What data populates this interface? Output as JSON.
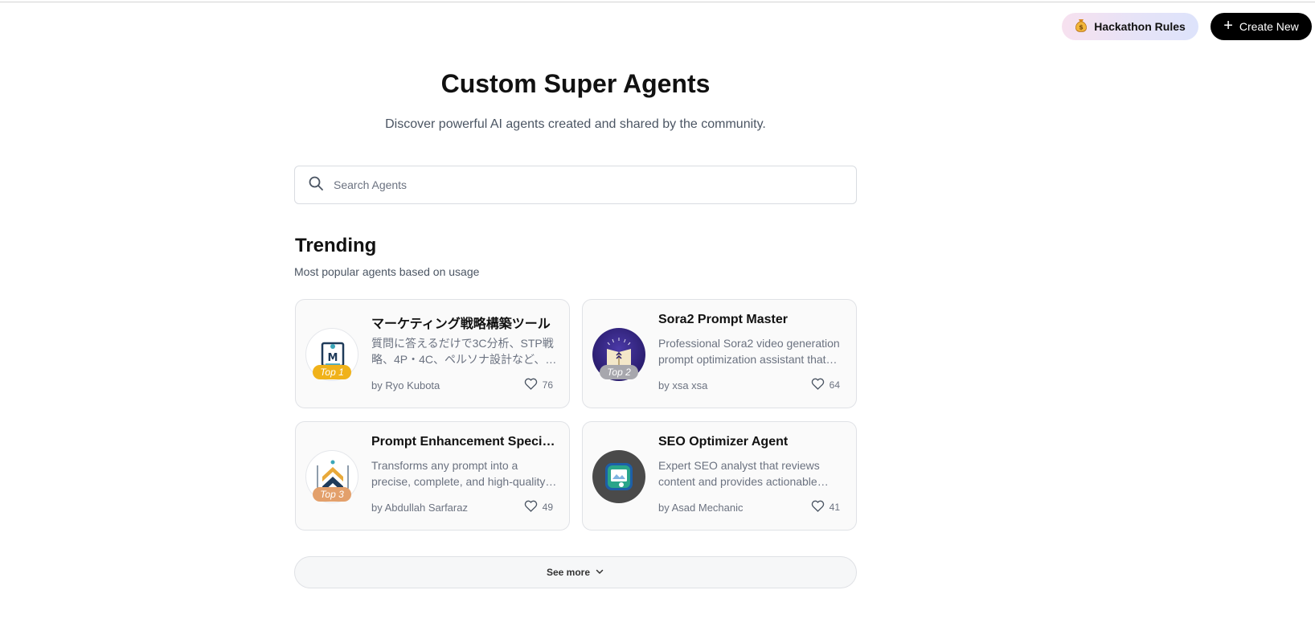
{
  "header": {
    "hackathon_rules_label": "Hackathon Rules",
    "hackathon_icon": "money-bag-icon",
    "create_new_label": "Create New"
  },
  "page": {
    "title": "Custom Super Agents",
    "subtitle": "Discover powerful AI agents created and shared by the community."
  },
  "search": {
    "placeholder": "Search Agents",
    "value": ""
  },
  "trending": {
    "title": "Trending",
    "subtitle": "Most popular agents based on usage",
    "agents": [
      {
        "title": "マーケティング戦略構築ツール",
        "description": "質問に答えるだけで3C分析、STP戦略、4P・4C、ペルソナ設計など、マーケティング戦略を構築",
        "author": "by Ryo Kubota",
        "likes": "76",
        "badge": "Top 1",
        "badge_color": "#f0b21a"
      },
      {
        "title": "Sora2 Prompt Master",
        "description": "Professional Sora2 video generation prompt optimization assistant that helps you create",
        "author": "by xsa xsa",
        "likes": "64",
        "badge": "Top 2",
        "badge_color": "#a7a7ad"
      },
      {
        "title": "Prompt Enhancement Specialist",
        "description": "Transforms any prompt into a precise, complete, and high-quality prompt",
        "author": "by Abdullah Sarfaraz",
        "likes": "49",
        "badge": "Top 3",
        "badge_color": "#e3a06b"
      },
      {
        "title": "SEO Optimizer Agent",
        "description": "Expert SEO analyst that reviews content and provides actionable recommendations",
        "author": "by Asad Mechanic",
        "likes": "41",
        "badge": "",
        "badge_color": ""
      }
    ]
  },
  "see_more": {
    "label": "See more"
  },
  "colors": {
    "accent": "#000000",
    "card_bg": "#fafafa",
    "border": "#e0e2e6"
  }
}
